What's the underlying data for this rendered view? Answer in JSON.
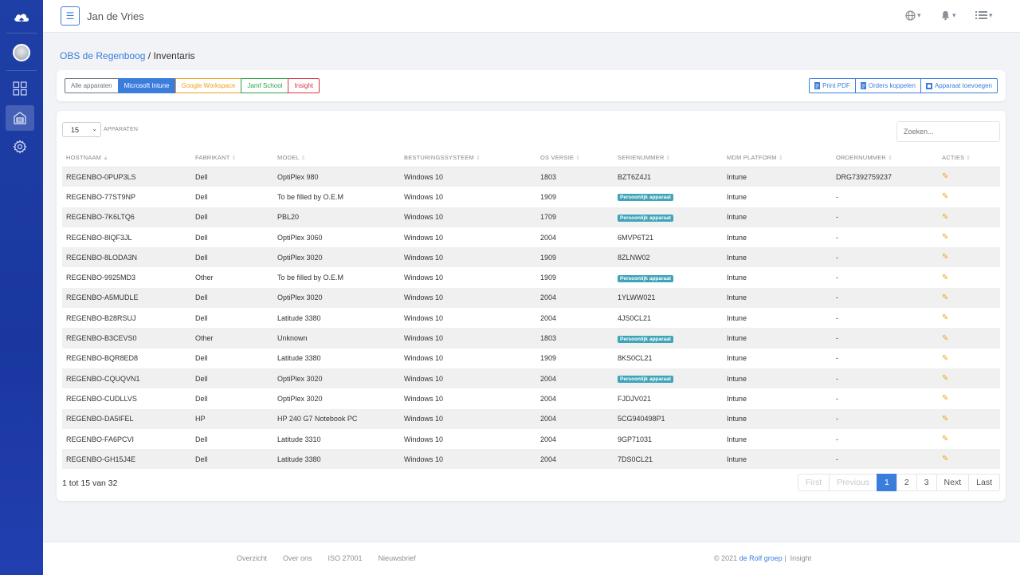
{
  "colors": {
    "primary": "#3b7ddd",
    "sidebar": "#1e3fa6",
    "badge": "#3fa4b8",
    "edit": "#f0a020"
  },
  "sidebar": {
    "logo_icon": "cloud-upload-icon",
    "items": [
      {
        "name": "dashboard",
        "icon": "grid-icon",
        "active": false
      },
      {
        "name": "inventory",
        "icon": "inventory-box-icon",
        "active": true
      },
      {
        "name": "settings",
        "icon": "gear-icon",
        "active": false
      }
    ]
  },
  "header": {
    "user_name": "Jan de Vries",
    "icons": [
      "globe-icon",
      "bell-icon",
      "list-icon"
    ]
  },
  "breadcrumb": {
    "parent": "OBS de Regenboog",
    "separator": "/",
    "current": "Inventaris"
  },
  "filters": [
    {
      "label": "Alle apparaten",
      "color": "#6c757d",
      "active": false
    },
    {
      "label": "Microsoft Intune",
      "color": "#3b7ddd",
      "active": true
    },
    {
      "label": "Google Workspace",
      "color": "#f0a020",
      "active": false
    },
    {
      "label": "Jamf School",
      "color": "#28a745",
      "active": false
    },
    {
      "label": "Insight",
      "color": "#dc3545",
      "active": false
    }
  ],
  "actions": {
    "print_pdf": "Print PDF",
    "link_orders": "Orders koppelen",
    "add_device": "Apparaat toevoegen"
  },
  "table": {
    "page_length": "15",
    "page_length_label": "APPARATEN",
    "search_placeholder": "Zoeken...",
    "columns": [
      "HOSTNAAM",
      "FABRIKANT",
      "MODEL",
      "BESTURINGSSYSTEEM",
      "OS VERSIE",
      "SERIENUMMER",
      "MDM PLATFORM",
      "ORDERNUMMER",
      "ACTIES"
    ],
    "rows": [
      {
        "hostname": "REGENBO-0PUP3LS",
        "vendor": "Dell",
        "model": "OptiPlex 980",
        "os": "Windows 10",
        "os_version": "1803",
        "serial": "BZT6Z4J1",
        "serial_badge": false,
        "mdm": "Intune",
        "order": "DRG7392759237"
      },
      {
        "hostname": "REGENBO-77ST9NP",
        "vendor": "Dell",
        "model": "To be filled by O.E.M",
        "os": "Windows 10",
        "os_version": "1909",
        "serial": "Persoonlijk apparaat",
        "serial_badge": true,
        "mdm": "Intune",
        "order": "-"
      },
      {
        "hostname": "REGENBO-7K6LTQ6",
        "vendor": "Dell",
        "model": "PBL20",
        "os": "Windows 10",
        "os_version": "1709",
        "serial": "Persoonlijk apparaat",
        "serial_badge": true,
        "mdm": "Intune",
        "order": "-"
      },
      {
        "hostname": "REGENBO-8IQF3JL",
        "vendor": "Dell",
        "model": "OptiPlex 3060",
        "os": "Windows 10",
        "os_version": "2004",
        "serial": "6MVP6T21",
        "serial_badge": false,
        "mdm": "Intune",
        "order": "-"
      },
      {
        "hostname": "REGENBO-8LODA3N",
        "vendor": "Dell",
        "model": "OptiPlex 3020",
        "os": "Windows 10",
        "os_version": "1909",
        "serial": "8ZLNW02",
        "serial_badge": false,
        "mdm": "Intune",
        "order": "-"
      },
      {
        "hostname": "REGENBO-9925MD3",
        "vendor": "Other",
        "model": "To be filled by O.E.M",
        "os": "Windows 10",
        "os_version": "1909",
        "serial": "Persoonlijk apparaat",
        "serial_badge": true,
        "mdm": "Intune",
        "order": "-"
      },
      {
        "hostname": "REGENBO-A5MUDLE",
        "vendor": "Dell",
        "model": "OptiPlex 3020",
        "os": "Windows 10",
        "os_version": "2004",
        "serial": "1YLWW021",
        "serial_badge": false,
        "mdm": "Intune",
        "order": "-"
      },
      {
        "hostname": "REGENBO-B28RSUJ",
        "vendor": "Dell",
        "model": "Latitude 3380",
        "os": "Windows 10",
        "os_version": "2004",
        "serial": "4JS0CL21",
        "serial_badge": false,
        "mdm": "Intune",
        "order": "-"
      },
      {
        "hostname": "REGENBO-B3CEVS0",
        "vendor": "Other",
        "model": "Unknown",
        "os": "Windows 10",
        "os_version": "1803",
        "serial": "Persoonlijk apparaat",
        "serial_badge": true,
        "mdm": "Intune",
        "order": "-"
      },
      {
        "hostname": "REGENBO-BQR8ED8",
        "vendor": "Dell",
        "model": "Latitude 3380",
        "os": "Windows 10",
        "os_version": "1909",
        "serial": "8KS0CL21",
        "serial_badge": false,
        "mdm": "Intune",
        "order": "-"
      },
      {
        "hostname": "REGENBO-CQUQVN1",
        "vendor": "Dell",
        "model": "OptiPlex 3020",
        "os": "Windows 10",
        "os_version": "2004",
        "serial": "Persoonlijk apparaat",
        "serial_badge": true,
        "mdm": "Intune",
        "order": "-"
      },
      {
        "hostname": "REGENBO-CUDLLVS",
        "vendor": "Dell",
        "model": "OptiPlex 3020",
        "os": "Windows 10",
        "os_version": "2004",
        "serial": "FJDJV021",
        "serial_badge": false,
        "mdm": "Intune",
        "order": "-"
      },
      {
        "hostname": "REGENBO-DA5IFEL",
        "vendor": "HP",
        "model": "HP 240 G7 Notebook PC",
        "os": "Windows 10",
        "os_version": "2004",
        "serial": "5CG940498P1",
        "serial_badge": false,
        "mdm": "Intune",
        "order": "-"
      },
      {
        "hostname": "REGENBO-FA6PCVI",
        "vendor": "Dell",
        "model": "Latitude 3310",
        "os": "Windows 10",
        "os_version": "2004",
        "serial": "9GP71031",
        "serial_badge": false,
        "mdm": "Intune",
        "order": "-"
      },
      {
        "hostname": "REGENBO-GH15J4E",
        "vendor": "Dell",
        "model": "Latitude 3380",
        "os": "Windows 10",
        "os_version": "2004",
        "serial": "7DS0CL21",
        "serial_badge": false,
        "mdm": "Intune",
        "order": "-"
      }
    ],
    "info": "1 tot 15 van 32"
  },
  "pagination": {
    "first": "First",
    "previous": "Previous",
    "pages": [
      "1",
      "2",
      "3"
    ],
    "current_page": "1",
    "next": "Next",
    "last": "Last"
  },
  "footer": {
    "links": [
      "Overzicht",
      "Over ons",
      "ISO 27001",
      "Nieuwsbrief"
    ],
    "copyright_prefix": "© 2021",
    "company": "de Rolf groep",
    "separator": "|",
    "product": "Insight"
  }
}
